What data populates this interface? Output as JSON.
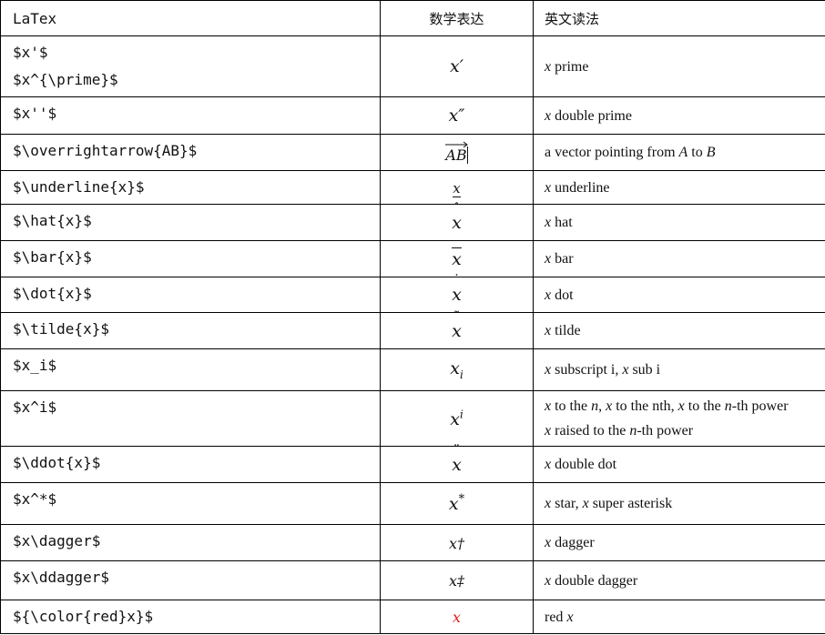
{
  "header": {
    "latex": "LaTex",
    "math": "数学表达",
    "english": "英文读法"
  },
  "rows": [
    {
      "latex": "$x'$\n$x^{\\prime}$",
      "math": "x′",
      "english": "x prime"
    },
    {
      "latex": "$x''$",
      "math": "x″",
      "english": "x double prime"
    },
    {
      "latex": "$\\overrightarrow{AB}$",
      "math": "AB",
      "english": "a vector pointing from A to B"
    },
    {
      "latex": "$\\underline{x}$",
      "math": "x",
      "english": "x underline"
    },
    {
      "latex": "$\\hat{x}$",
      "math": "x",
      "english": "x hat"
    },
    {
      "latex": "$\\bar{x}$",
      "math": "x",
      "english": "x bar"
    },
    {
      "latex": "$\\dot{x}$",
      "math": "x",
      "english": "x dot"
    },
    {
      "latex": "$\\tilde{x}$",
      "math": "x",
      "english": "x tilde"
    },
    {
      "latex": "$x_i$",
      "math": "xi",
      "english": "x subscript i, x sub i"
    },
    {
      "latex": "$x^i$",
      "math": "xi",
      "english": "x to the n, x to the nth, x to the n-th power x raised to the n-th power"
    },
    {
      "latex": "$\\ddot{x}$",
      "math": "x",
      "english": "x double dot"
    },
    {
      "latex": "$x^*$",
      "math": "x*",
      "english": "x star, x super asterisk"
    },
    {
      "latex": "$x\\dagger$",
      "math": "x†",
      "english": "x dagger"
    },
    {
      "latex": "$x\\ddagger$",
      "math": "x‡",
      "english": "x double dagger"
    },
    {
      "latex": "${\\color{red}x}$",
      "math": "x",
      "english": "red x"
    }
  ],
  "marks": {
    "hat": "ˆ",
    "dot": "˙",
    "tilde": "˜",
    "ddot": "¨"
  },
  "colors": {
    "red": "#e0201c",
    "border": "#000000"
  }
}
